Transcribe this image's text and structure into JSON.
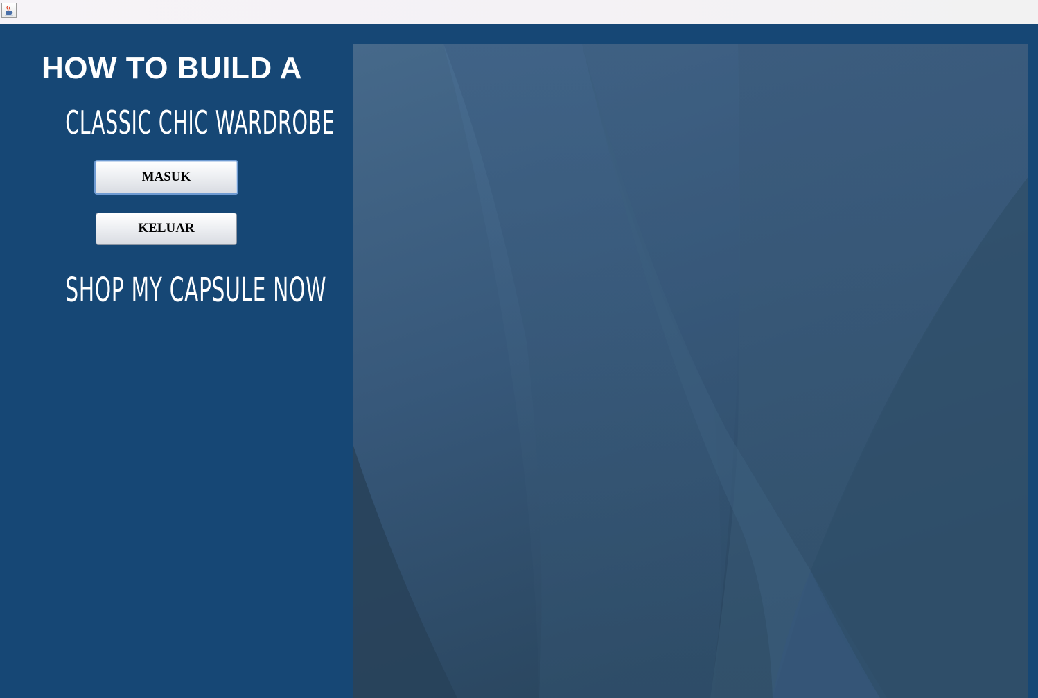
{
  "window": {
    "app_icon": "java-coffee-cup-icon"
  },
  "main": {
    "heading": "HOW TO BUILD A",
    "subheading": "CLASSIC CHIC WARDROBE",
    "tagline": "SHOP MY CAPSULE NOW"
  },
  "buttons": {
    "enter_label": "MASUK",
    "exit_label": "KELUAR"
  },
  "image": {
    "description_icon": "abstract-blue-wave-wallpaper"
  },
  "colors": {
    "background": "#164775",
    "text": "#ffffff"
  }
}
